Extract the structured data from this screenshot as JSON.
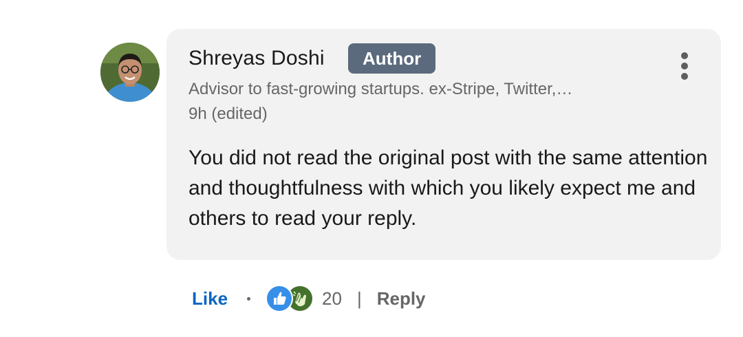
{
  "comment": {
    "author_name": "Shreyas Doshi",
    "author_badge": "Author",
    "author_headline": "Advisor to fast-growing startups. ex-Stripe, Twitter,…",
    "timestamp": "9h (edited)",
    "text": "You did not read the original post with the same attention and thoughtfulness with which you likely expect me and others to read your reply.",
    "avatar_icon": "profile-photo",
    "more_icon": "vertical-ellipsis-icon"
  },
  "actions": {
    "like_label": "Like",
    "separator": "|",
    "reaction_count": "20",
    "reaction_icons": [
      "like-reaction-icon",
      "celebrate-reaction-icon"
    ],
    "reply_label": "Reply"
  },
  "colors": {
    "accent": "#0a66c2",
    "badge_bg": "#5b6a7c",
    "bubble_bg": "#f2f2f2",
    "muted_text": "#666666"
  }
}
